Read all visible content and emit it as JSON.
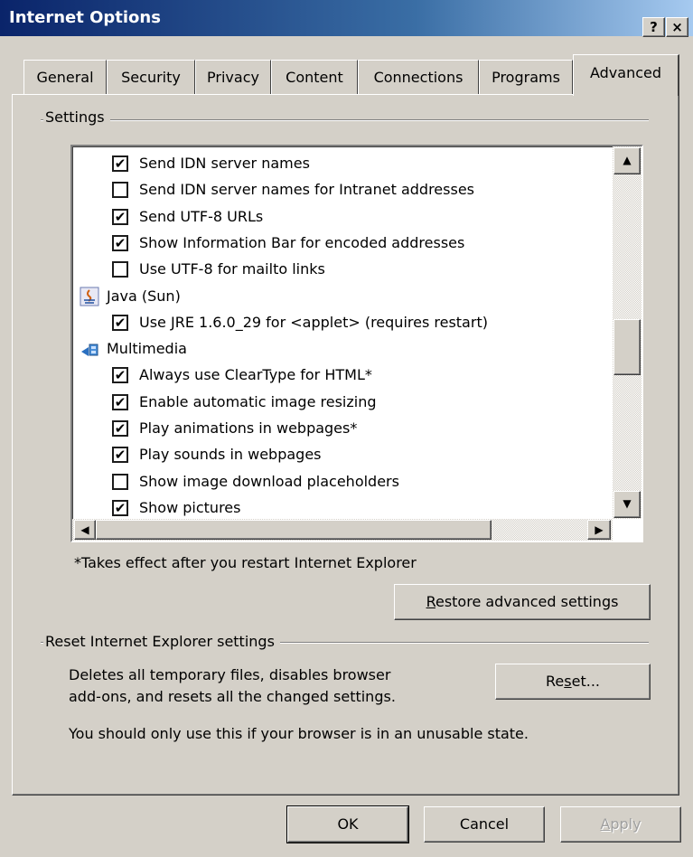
{
  "window": {
    "title": "Internet Options",
    "help_button": "?",
    "close_button": "×"
  },
  "tabs": [
    {
      "label": "General"
    },
    {
      "label": "Security"
    },
    {
      "label": "Privacy"
    },
    {
      "label": "Content"
    },
    {
      "label": "Connections"
    },
    {
      "label": "Programs"
    },
    {
      "label": "Advanced",
      "active": true
    }
  ],
  "settings": {
    "group_label": "Settings",
    "items": [
      {
        "type": "checkbox",
        "checked": true,
        "label": "Send IDN server names"
      },
      {
        "type": "checkbox",
        "checked": false,
        "label": "Send IDN server names for Intranet addresses"
      },
      {
        "type": "checkbox",
        "checked": true,
        "label": "Send UTF-8 URLs"
      },
      {
        "type": "checkbox",
        "checked": true,
        "label": "Show Information Bar for encoded addresses"
      },
      {
        "type": "checkbox",
        "checked": false,
        "label": "Use UTF-8 for mailto links"
      },
      {
        "type": "category",
        "icon": "java-icon",
        "label": "Java (Sun)"
      },
      {
        "type": "checkbox",
        "checked": true,
        "label": "Use JRE 1.6.0_29 for <applet> (requires restart)"
      },
      {
        "type": "category",
        "icon": "multimedia-icon",
        "label": "Multimedia"
      },
      {
        "type": "checkbox",
        "checked": true,
        "label": "Always use ClearType for HTML*"
      },
      {
        "type": "checkbox",
        "checked": true,
        "label": "Enable automatic image resizing"
      },
      {
        "type": "checkbox",
        "checked": true,
        "label": "Play animations in webpages*"
      },
      {
        "type": "checkbox",
        "checked": true,
        "label": "Play sounds in webpages"
      },
      {
        "type": "checkbox",
        "checked": false,
        "label": "Show image download placeholders"
      },
      {
        "type": "checkbox",
        "checked": true,
        "label": "Show pictures"
      }
    ],
    "check_glyph": "✔",
    "restart_note": "*Takes effect after you restart Internet Explorer",
    "restore_button": {
      "pre": "",
      "accel": "R",
      "post": "estore advanced settings"
    }
  },
  "reset": {
    "group_label": "Reset Internet Explorer settings",
    "description_line1": "Deletes all temporary files, disables browser",
    "description_line2": "add-ons, and resets all the changed settings.",
    "reset_button": {
      "pre": "Re",
      "accel": "s",
      "post": "et..."
    },
    "warning": "You should only use this if your browser is in an unusable state."
  },
  "footer": {
    "ok": "OK",
    "cancel": "Cancel",
    "apply": {
      "pre": "",
      "accel": "A",
      "post": "pply"
    }
  },
  "scrollbar_arrows": {
    "up": "▲",
    "down": "▼",
    "left": "◀",
    "right": "▶"
  }
}
